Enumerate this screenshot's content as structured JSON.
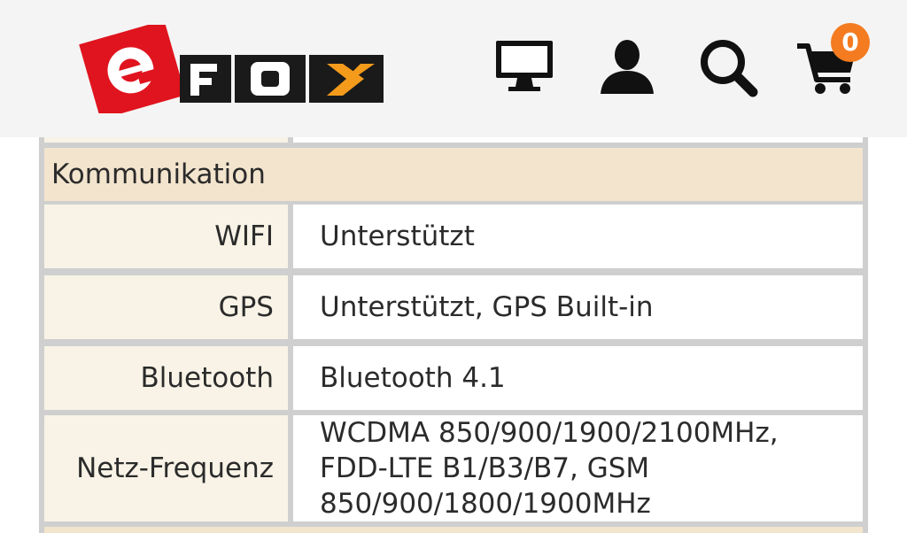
{
  "header": {
    "logo_text": "eFOX",
    "cart_count": "0",
    "icons": [
      "monitor-icon",
      "user-icon",
      "search-icon",
      "cart-icon"
    ],
    "colors": {
      "header_bg": "#f4f4f4",
      "logo_red": "#e0141e",
      "logo_orange": "#f49b1c",
      "badge": "#f47b20"
    }
  },
  "specs": {
    "section_title": "Kommunikation",
    "rows": [
      {
        "label": "WIFI",
        "value": "Unterstützt"
      },
      {
        "label": "GPS",
        "value": "Unterstützt, GPS Built-in"
      },
      {
        "label": "Bluetooth",
        "value": "Bluetooth 4.1"
      },
      {
        "label": "Netz-Frequenz",
        "value": "WCDMA 850/900/1900/2100MHz, FDD-LTE B1/B3/B7, GSM 850/900/1800/1900MHz"
      }
    ],
    "colors": {
      "section_bg": "#f3e4cd",
      "label_bg": "#f8f3e6",
      "value_bg": "#ffffff",
      "border": "#cfcfcf"
    }
  }
}
